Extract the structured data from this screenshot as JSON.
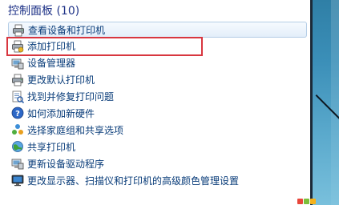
{
  "header": {
    "title": "控制面板 (10)"
  },
  "items": [
    {
      "label": "查看设备和打印机",
      "icon": "printer-icon"
    },
    {
      "label": "添加打印机",
      "icon": "printer-add-icon"
    },
    {
      "label": "设备管理器",
      "icon": "device-manager-icon"
    },
    {
      "label": "更改默认打印机",
      "icon": "printer-icon"
    },
    {
      "label": "找到并修复打印问题",
      "icon": "troubleshoot-icon"
    },
    {
      "label": "如何添加新硬件",
      "icon": "help-icon"
    },
    {
      "label": "选择家庭组和共享选项",
      "icon": "homegroup-icon"
    },
    {
      "label": "共享打印机",
      "icon": "network-icon"
    },
    {
      "label": "更新设备驱动程序",
      "icon": "device-manager-icon"
    },
    {
      "label": "更改显示器、扫描仪和打印机的高级颜色管理设置",
      "icon": "monitor-icon"
    }
  ],
  "colors": {
    "header_text": "#1e3287",
    "link_text": "#0a3d7a",
    "highlight_border": "#d8363f",
    "hover_border": "#b4cde6"
  }
}
